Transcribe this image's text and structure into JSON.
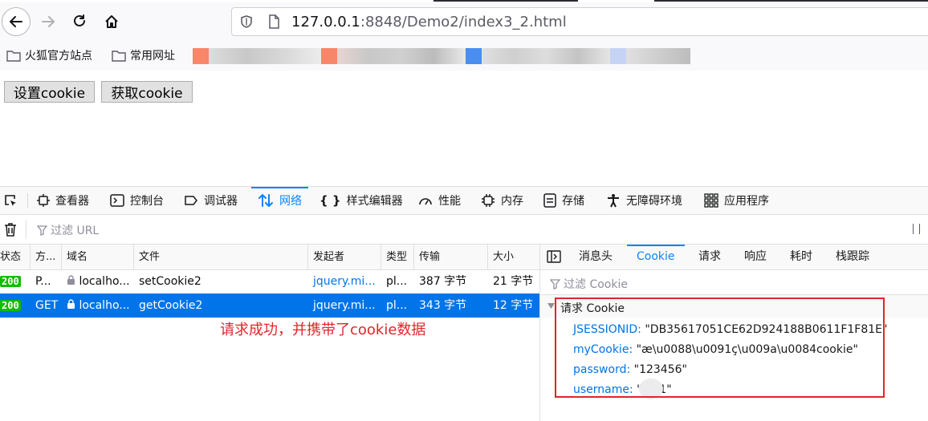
{
  "browser": {
    "url_scheme_host": "127.0.0.1",
    "url_rest": ":8848/Demo2/index3_2.html",
    "bookmarks": [
      "火狐官方站点",
      "常用网址"
    ]
  },
  "page": {
    "buttons": [
      "设置cookie",
      "获取cookie"
    ]
  },
  "devtools": {
    "tabs": [
      {
        "label": "查看器",
        "icon": "inspector-icon"
      },
      {
        "label": "控制台",
        "icon": "console-icon"
      },
      {
        "label": "调试器",
        "icon": "debugger-icon"
      },
      {
        "label": "网络",
        "icon": "network-icon"
      },
      {
        "label": "样式编辑器",
        "icon": "style-editor-icon"
      },
      {
        "label": "性能",
        "icon": "performance-icon"
      },
      {
        "label": "内存",
        "icon": "memory-icon"
      },
      {
        "label": "存储",
        "icon": "storage-icon"
      },
      {
        "label": "无障碍环境",
        "icon": "accessibility-icon"
      },
      {
        "label": "应用程序",
        "icon": "application-icon"
      }
    ],
    "filter_placeholder": "过滤 URL",
    "columns": [
      "状态",
      "方...",
      "域名",
      "文件",
      "发起者",
      "类型",
      "传输",
      "大小"
    ],
    "requests": [
      {
        "status": "200",
        "method": "P...",
        "domain": "localho...",
        "file": "setCookie2",
        "initiator": "jquery.mi...",
        "type": "pl...",
        "transfer": "387 字节",
        "size": "21 字节"
      },
      {
        "status": "200",
        "method": "GET",
        "domain": "localho...",
        "file": "getCookie2",
        "initiator": "jquery.mi...",
        "type": "pl...",
        "transfer": "343 字节",
        "size": "12 字节"
      }
    ],
    "side_tabs": [
      "消息头",
      "Cookie",
      "请求",
      "响应",
      "耗时",
      "栈跟踪"
    ],
    "side_filter_placeholder": "过滤 Cookie",
    "cookie_section_title": "请求 Cookie",
    "cookies": [
      {
        "key": "JSESSIONID:",
        "value": "\"DB35617051CE62D924188B0611F1F81E\""
      },
      {
        "key": "myCookie:",
        "value": "\"æ\\u0088\\u0091ç\\u009a\\u0084cookie\""
      },
      {
        "key": "password:",
        "value": "\"123456\""
      },
      {
        "key": "username:",
        "value": "\"l    1\""
      }
    ]
  },
  "annotation": "请求成功，并携带了cookie数据",
  "colors": {
    "accent": "#0a84ff",
    "selected_row": "#0074e8",
    "status_ok": "#12bc00",
    "annotation": "#e0252a"
  }
}
